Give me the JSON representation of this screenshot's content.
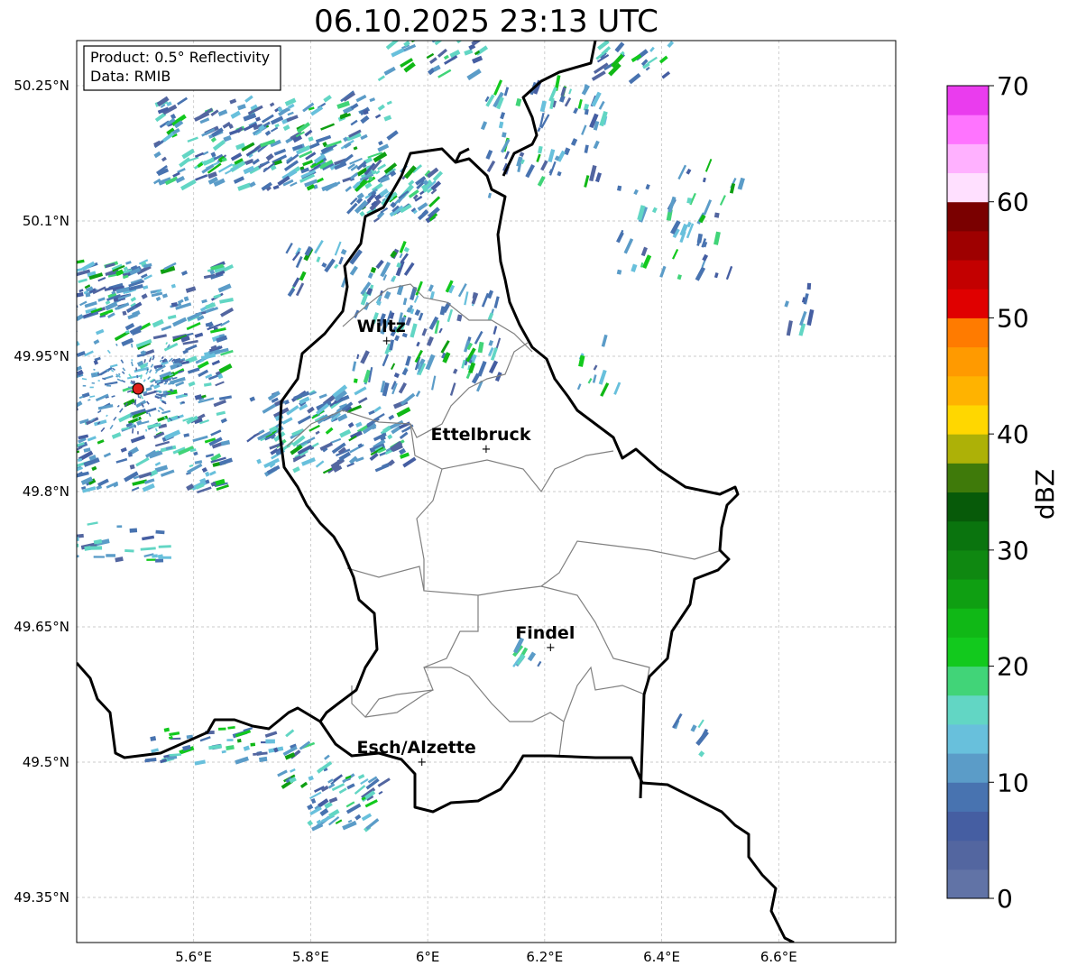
{
  "title": "06.10.2025 23:13 UTC",
  "info_box": {
    "product": "Product: 0.5° Reflectivity",
    "data": "Data: RMIB"
  },
  "map_extent": {
    "lon_min": 5.4,
    "lon_max": 6.8,
    "lat_min": 49.3,
    "lat_max": 50.3
  },
  "lon_ticks": [
    {
      "value": 5.6,
      "label": "5.6°E"
    },
    {
      "value": 5.8,
      "label": "5.8°E"
    },
    {
      "value": 6.0,
      "label": "6°E"
    },
    {
      "value": 6.2,
      "label": "6.2°E"
    },
    {
      "value": 6.4,
      "label": "6.4°E"
    },
    {
      "value": 6.6,
      "label": "6.6°E"
    }
  ],
  "lat_ticks": [
    {
      "value": 50.25,
      "label": "50.25°N"
    },
    {
      "value": 50.1,
      "label": "50.1°N"
    },
    {
      "value": 49.95,
      "label": "49.95°N"
    },
    {
      "value": 49.8,
      "label": "49.8°N"
    },
    {
      "value": 49.65,
      "label": "49.65°N"
    },
    {
      "value": 49.5,
      "label": "49.5°N"
    },
    {
      "value": 49.35,
      "label": "49.35°N"
    }
  ],
  "cities": [
    {
      "name": "Wiltz",
      "lon": 5.93,
      "lat": 49.967
    },
    {
      "name": "Ettelbruck",
      "lon": 6.1,
      "lat": 49.847
    },
    {
      "name": "Findel",
      "lon": 6.21,
      "lat": 49.627
    },
    {
      "name": "Esch/Alzette",
      "lon": 5.99,
      "lat": 49.5
    }
  ],
  "radar_site": {
    "lon": 5.505,
    "lat": 49.914,
    "color": "#e0201b"
  },
  "colorbar": {
    "label": "dBZ",
    "min": 0,
    "max": 70,
    "ticks": [
      {
        "value": 0,
        "label": "0"
      },
      {
        "value": 10,
        "label": "10"
      },
      {
        "value": 20,
        "label": "20"
      },
      {
        "value": 30,
        "label": "30"
      },
      {
        "value": 40,
        "label": "40"
      },
      {
        "value": 50,
        "label": "50"
      },
      {
        "value": 60,
        "label": "60"
      },
      {
        "value": 70,
        "label": "70"
      }
    ],
    "colors": [
      "#6173a6",
      "#5366a0",
      "#455ea2",
      "#4873b0",
      "#5b9cc8",
      "#68c0dc",
      "#62d6c4",
      "#41d478",
      "#12c91d",
      "#10b816",
      "#0f9f12",
      "#0f8811",
      "#0a740e",
      "#075a09",
      "#3f7a0a",
      "#adb107",
      "#ffd700",
      "#ffb300",
      "#ff9a00",
      "#ff7b00",
      "#e00000",
      "#c30000",
      "#9e0000",
      "#7a0000",
      "#ffe0ff",
      "#ffb1ff",
      "#ff74ff",
      "#ea3cee"
    ]
  }
}
